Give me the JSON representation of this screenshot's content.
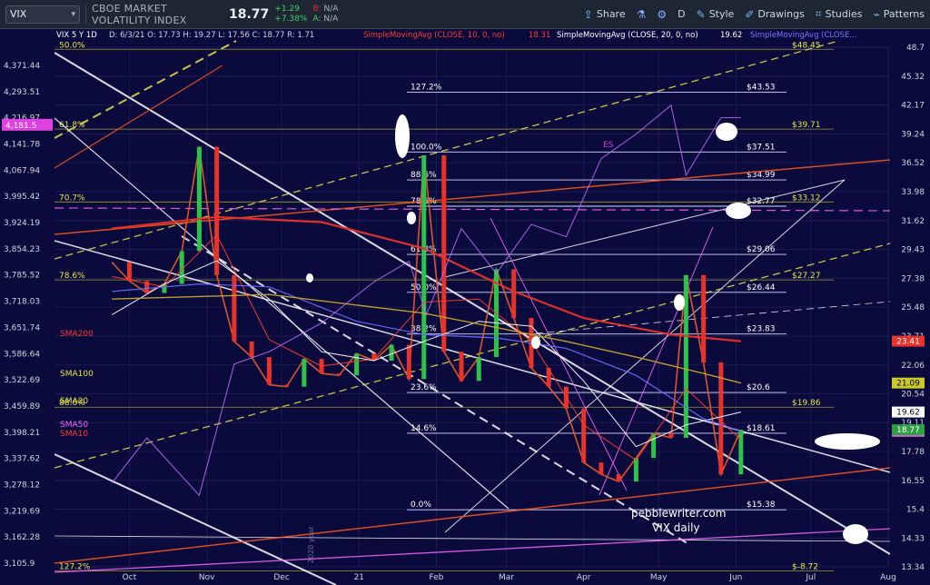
{
  "toolbar": {
    "symbol": "VIX",
    "name": "CBOE MARKET VOLATILITY INDEX",
    "last": "18.77",
    "change": "+1.29",
    "change_pct": "+7.38%",
    "bid": "N/A",
    "ask": "N/A",
    "share": "Share",
    "interval": "D",
    "style": "Style",
    "drawings": "Drawings",
    "studies": "Studies",
    "patterns": "Patterns"
  },
  "legend": {
    "title": "VIX 5 Y 1D",
    "ohlc": "D: 6/3/21  O: 17.73  H: 19.27  L: 17.56  C: 18.77  R: 1.71",
    "sma10": "SimpleMovingAvg (CLOSE, 10, 0, no)",
    "sma10_val": "18.31",
    "sma20": "SimpleMovingAvg (CLOSE, 20, 0, no)",
    "sma20_val": "19.62",
    "sma_other": "SimpleMovingAvg (CLOSE..."
  },
  "watermark": {
    "site": "pebblewriter.com",
    "sub": "VIX daily",
    "year": "2020 year"
  },
  "annotations": {
    "es": "ES",
    "sma200": "SMA200",
    "sma100": "SMA100",
    "sma20": "SMA20",
    "sma50": "SMA50",
    "sma10": "SMA10",
    "fib_right": [
      {
        "label": "127.2%",
        "price": "$43.53",
        "y": 43.53
      },
      {
        "label": "100.0%",
        "price": "$37.51",
        "y": 37.51
      },
      {
        "label": "88.6%",
        "price": "$34.99",
        "y": 34.99
      },
      {
        "label": "78.6%",
        "price": "$32.77",
        "y": 32.77
      },
      {
        "label": "61.8%",
        "price": "$29.06",
        "y": 29.06
      },
      {
        "label": "50.0%",
        "price": "$26.44",
        "y": 26.44
      },
      {
        "label": "38.2%",
        "price": "$23.83",
        "y": 23.83
      },
      {
        "label": "23.6%",
        "price": "$20.6",
        "y": 20.6
      },
      {
        "label": "14.6%",
        "price": "$18.61",
        "y": 18.61
      },
      {
        "label": "0.0%",
        "price": "$15.38",
        "y": 15.38
      }
    ],
    "fib_left": [
      {
        "label": "50.0%",
        "price": "$48.45",
        "y": 48.45
      },
      {
        "label": "61.8%",
        "price": "$39.71",
        "y": 39.71
      },
      {
        "label": "70.7%",
        "price": "$33.12",
        "y": 33.12
      },
      {
        "label": "78.6%",
        "price": "$27.27",
        "y": 27.27
      },
      {
        "label": "88.6%",
        "price": "$19.86",
        "y": 19.86
      },
      {
        "label": "127.2%",
        "price": "$-8.72",
        "y": 13.2
      }
    ]
  },
  "chart_data": {
    "type": "line",
    "title": "VIX 5 Y 1D",
    "xlabel": "",
    "ylabel": "",
    "x_ticks": [
      "Oct",
      "Nov",
      "Dec",
      "21",
      "Feb",
      "Mar",
      "Apr",
      "May",
      "Jun",
      "Jul",
      "Aug"
    ],
    "y_ticks_right": [
      "48.7",
      "45.32",
      "42.17",
      "39.24",
      "36.52",
      "33.98",
      "31.62",
      "29.43",
      "27.38",
      "25.48",
      "23.71",
      "22.06",
      "20.54",
      "19.11",
      "17.78",
      "16.55",
      "15.4",
      "14.33",
      "13.34"
    ],
    "y_ticks_left": [
      "4,371.44",
      "4,293.51",
      "4,216.97",
      "4,141.78",
      "4,067.94",
      "3,995.42",
      "3,924.19",
      "3,854.23",
      "3,785.52",
      "3,718.03",
      "3,651.74",
      "3,586.64",
      "3,522.69",
      "3,459.89",
      "3,398.21",
      "3,337.62",
      "3,278.12",
      "3,219.69",
      "3,162.28",
      "3,105.9"
    ],
    "left_price_label": "4,181.5",
    "ylim": [
      13.34,
      48.7
    ],
    "y_scale": "log",
    "price_flags": [
      {
        "value": "23.41",
        "color": "#e8322a"
      },
      {
        "value": "21.09",
        "color": "#c9c92a"
      },
      {
        "value": "19.62",
        "color": "#ffffff"
      },
      {
        "value": "18.7",
        "color": "#e060e0"
      },
      {
        "value": "18.77",
        "color": "#2ea043"
      }
    ],
    "series": [
      {
        "name": "VIX 5 Y 1D",
        "dates": [
          "2020-09-24",
          "2020-10-01",
          "2020-10-08",
          "2020-10-15",
          "2020-10-22",
          "2020-10-29",
          "2020-11-05",
          "2020-11-12",
          "2020-11-19",
          "2020-11-26",
          "2020-12-03",
          "2020-12-10",
          "2020-12-17",
          "2020-12-24",
          "2020-12-31",
          "2021-01-07",
          "2021-01-14",
          "2021-01-21",
          "2021-01-27",
          "2021-02-04",
          "2021-02-11",
          "2021-02-18",
          "2021-02-25",
          "2021-03-04",
          "2021-03-11",
          "2021-03-18",
          "2021-03-25",
          "2021-04-01",
          "2021-04-08",
          "2021-04-15",
          "2021-04-22",
          "2021-04-29",
          "2021-05-06",
          "2021-05-12",
          "2021-05-19",
          "2021-05-26",
          "2021-06-03"
        ],
        "values": [
          28.5,
          27.2,
          26.4,
          27.0,
          29.3,
          38.0,
          27.6,
          23.4,
          22.5,
          21.0,
          20.9,
          22.4,
          21.6,
          21.5,
          22.7,
          22.3,
          23.2,
          21.3,
          37.2,
          22.8,
          21.2,
          22.5,
          28.0,
          24.8,
          21.9,
          20.9,
          19.8,
          17.3,
          16.8,
          16.5,
          17.5,
          18.6,
          18.4,
          27.6,
          22.2,
          16.8,
          18.77
        ]
      },
      {
        "name": "SMA10",
        "dates": [
          "2020-09-24",
          "2020-10-15",
          "2020-11-05",
          "2020-11-26",
          "2020-12-17",
          "2021-01-07",
          "2021-01-27",
          "2021-02-18",
          "2021-03-11",
          "2021-04-01",
          "2021-04-22",
          "2021-05-12",
          "2021-06-03"
        ],
        "values": [
          27.5,
          26.8,
          30.5,
          23.5,
          22.0,
          22.4,
          25.8,
          26.0,
          23.4,
          19.0,
          17.4,
          20.8,
          18.31
        ]
      },
      {
        "name": "SMA20",
        "dates": [
          "2020-09-24",
          "2020-10-15",
          "2020-11-05",
          "2020-11-26",
          "2020-12-17",
          "2021-01-07",
          "2021-01-27",
          "2021-02-18",
          "2021-03-11",
          "2021-04-01",
          "2021-04-22",
          "2021-05-12",
          "2021-06-03"
        ],
        "values": [
          25.0,
          27.0,
          28.6,
          26.0,
          22.8,
          22.3,
          23.4,
          24.6,
          24.3,
          21.2,
          18.0,
          19.0,
          19.62
        ]
      },
      {
        "name": "SMA50",
        "dates": [
          "2020-09-24",
          "2020-10-29",
          "2020-11-26",
          "2020-12-31",
          "2021-01-27",
          "2021-02-25",
          "2021-03-25",
          "2021-04-22",
          "2021-05-19",
          "2021-06-03"
        ],
        "values": [
          26.5,
          27.0,
          26.8,
          24.6,
          23.8,
          23.6,
          23.0,
          21.5,
          19.3,
          18.7
        ]
      },
      {
        "name": "SMA100",
        "dates": [
          "2020-09-24",
          "2020-11-26",
          "2021-01-27",
          "2021-03-25",
          "2021-04-22",
          "2021-05-19",
          "2021-06-03"
        ],
        "values": [
          26.0,
          26.3,
          25.1,
          23.4,
          22.5,
          21.6,
          21.09
        ]
      },
      {
        "name": "SMA200",
        "dates": [
          "2020-09-24",
          "2020-11-05",
          "2020-12-17",
          "2021-01-27",
          "2021-03-04",
          "2021-04-01",
          "2021-05-06",
          "2021-06-03"
        ],
        "values": [
          31.0,
          31.9,
          31.5,
          29.5,
          26.5,
          24.8,
          23.8,
          23.41
        ]
      },
      {
        "name": "ES",
        "dates": [
          "2020-09-24",
          "2020-10-08",
          "2020-10-29",
          "2020-11-12",
          "2020-11-26",
          "2020-12-17",
          "2021-01-07",
          "2021-01-21",
          "2021-01-28",
          "2021-02-11",
          "2021-02-25",
          "2021-03-11",
          "2021-03-25",
          "2021-04-08",
          "2021-04-22",
          "2021-05-06",
          "2021-05-12",
          "2021-05-26",
          "2021-06-03"
        ],
        "values": [
          3310,
          3420,
          3280,
          3600,
          3630,
          3700,
          3800,
          3850,
          3720,
          3930,
          3820,
          3940,
          3910,
          4100,
          4160,
          4230,
          4060,
          4200,
          4200
        ]
      }
    ],
    "fib_levels": [
      43.53,
      37.51,
      34.99,
      32.77,
      29.06,
      26.44,
      23.83,
      20.6,
      18.61,
      15.38
    ]
  }
}
